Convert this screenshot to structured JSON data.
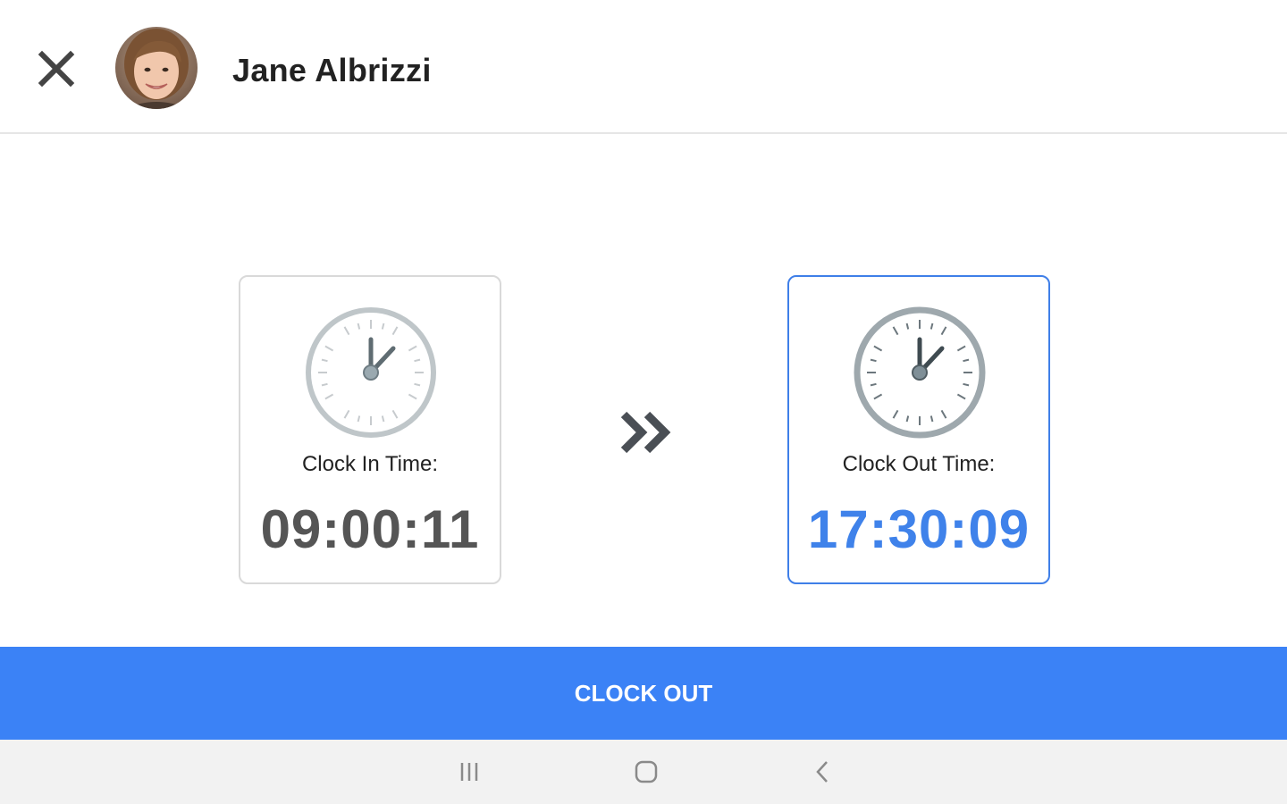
{
  "header": {
    "close_icon": "close-icon",
    "user_name": "Jane Albrizzi"
  },
  "clock_in": {
    "label": "Clock In Time:",
    "time": "09:00:11",
    "icon": "clock-icon"
  },
  "transition_icon": "double-chevron-right-icon",
  "clock_out": {
    "label": "Clock Out Time:",
    "time": "17:30:09",
    "icon": "clock-icon"
  },
  "action": {
    "clock_out_label": "CLOCK OUT"
  },
  "nav_bar": {
    "recents_icon": "recents-icon",
    "home_icon": "home-icon",
    "back_icon": "back-icon"
  },
  "colors": {
    "accent": "#3b82f6",
    "clock_out_time": "#3f82ea",
    "clock_in_time": "#555555",
    "selected_border": "#3f7fe8"
  }
}
